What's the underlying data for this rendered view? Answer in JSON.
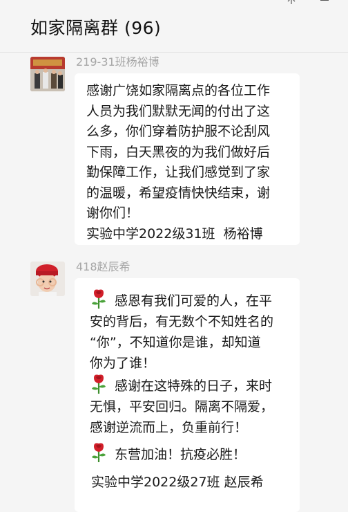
{
  "window": {
    "title": "如家隔离群 (96)",
    "pin_icon": "pin-icon",
    "minimize_icon": "minimize-icon"
  },
  "messages": [
    {
      "sender": "219-31班杨裕博",
      "avatar_icon": "avatar-photo-group",
      "lines": [
        "感谢广饶如家隔离点的各位工作",
        "人员为我们默默无闻的付出了这",
        "么多，你们穿着防护服不论刮风",
        "下雨，白天黑夜的为我们做好后",
        "勤保障工作，让我们感觉到了家",
        "的温暖，希望疫情快快结束，谢",
        "谢你们！",
        "实验中学2022级31班  杨裕博"
      ]
    },
    {
      "sender": "418赵辰希",
      "avatar_icon": "avatar-photo-child",
      "rose_icon": "rose-emoji-icon",
      "lines": [
        "感恩有我们可爱的人，在平",
        "安的背后，有无数个不知姓名的",
        "“你”，不知道你是谁，却知道",
        "你为了谁！",
        "感谢在这特殊的日子，来时",
        "无惧，平安回归。隔离不隔爱，",
        "感谢逆流而上，负重前行！",
        "东营加油！抗疫必胜！",
        "实验中学2022级27班 赵辰希"
      ]
    }
  ],
  "colors": {
    "background": "#f5f5f5",
    "bubble": "#ffffff",
    "sender_name": "#a6a6a6",
    "text": "#1a1a1a"
  }
}
